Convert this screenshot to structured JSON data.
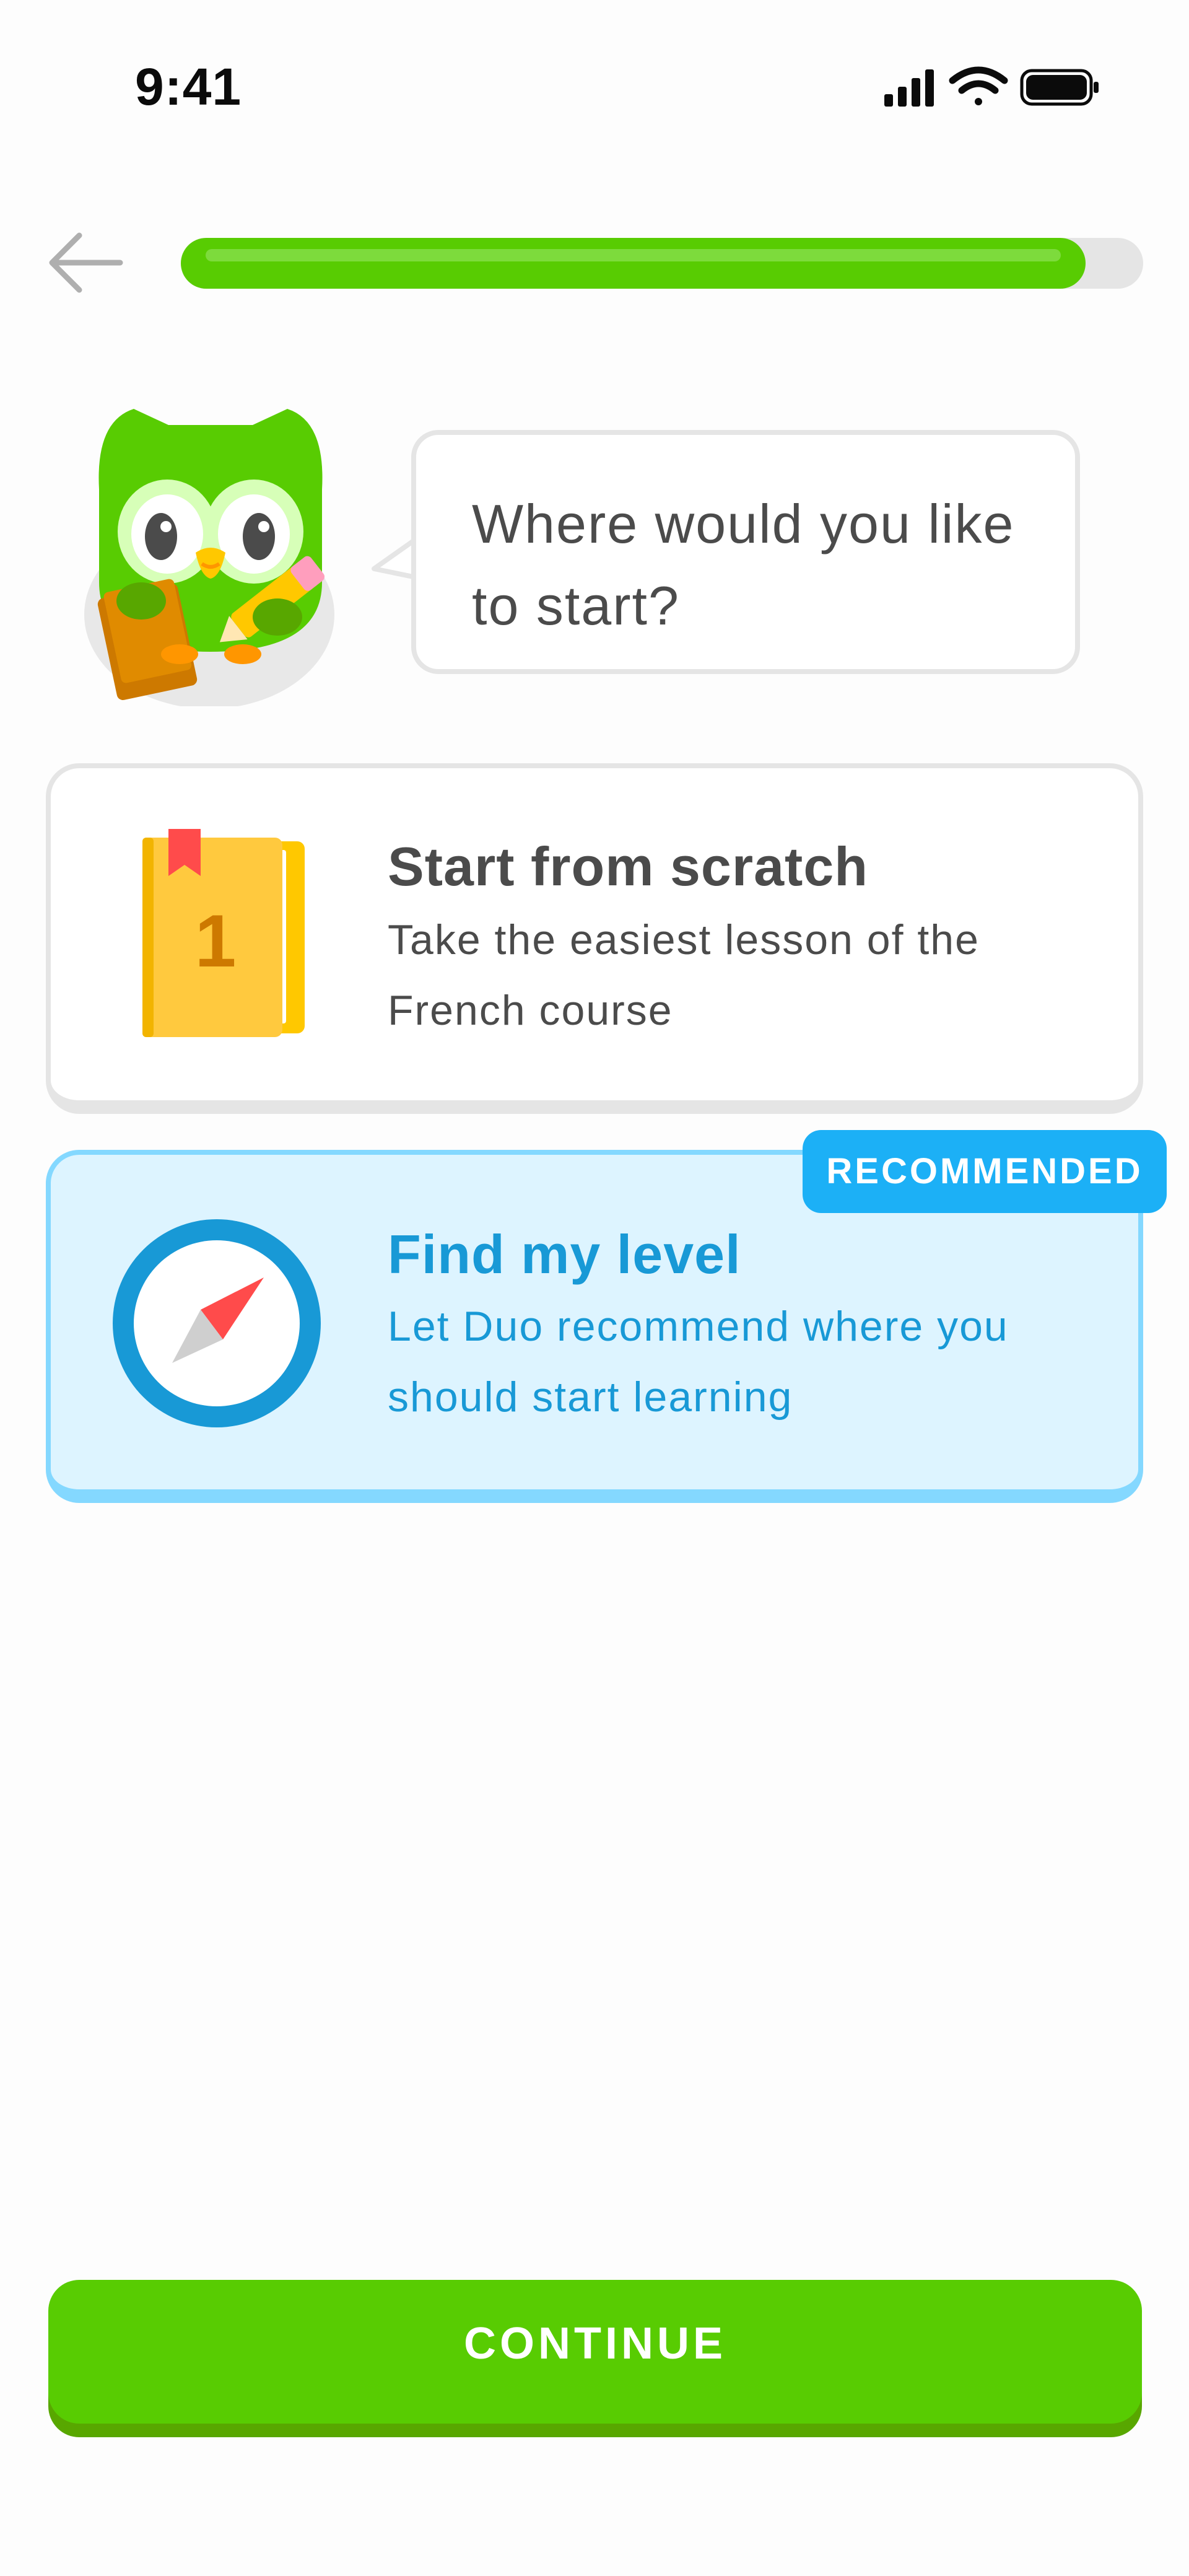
{
  "status_bar": {
    "time": "9:41",
    "icons": [
      "signal-icon",
      "wifi-icon",
      "battery-icon"
    ]
  },
  "header": {
    "back_icon": "arrow-left-icon",
    "progress": 0.94
  },
  "prompt": {
    "mascot": "duo-owl-icon",
    "question": "Where would you like to start?"
  },
  "options": [
    {
      "id": "start-from-scratch",
      "icon": "book-icon",
      "title": "Start from scratch",
      "description": "Take the easiest lesson of the French course",
      "book_number": "1",
      "selected": false
    },
    {
      "id": "find-my-level",
      "icon": "compass-icon",
      "title": "Find my level",
      "description": "Let Duo recommend where you should start learning",
      "badge": "RECOMMENDED",
      "selected": true
    }
  ],
  "footer": {
    "continue_label": "CONTINUE"
  },
  "colors": {
    "brand_green": "#58cc02",
    "brand_green_shadow": "#58a700",
    "selected_blue": "#1cb0f6",
    "selected_bg": "#ddf4ff",
    "selected_border": "#84d8ff",
    "text_dark": "#4b4b4b",
    "border_gray": "#e5e5e5"
  }
}
